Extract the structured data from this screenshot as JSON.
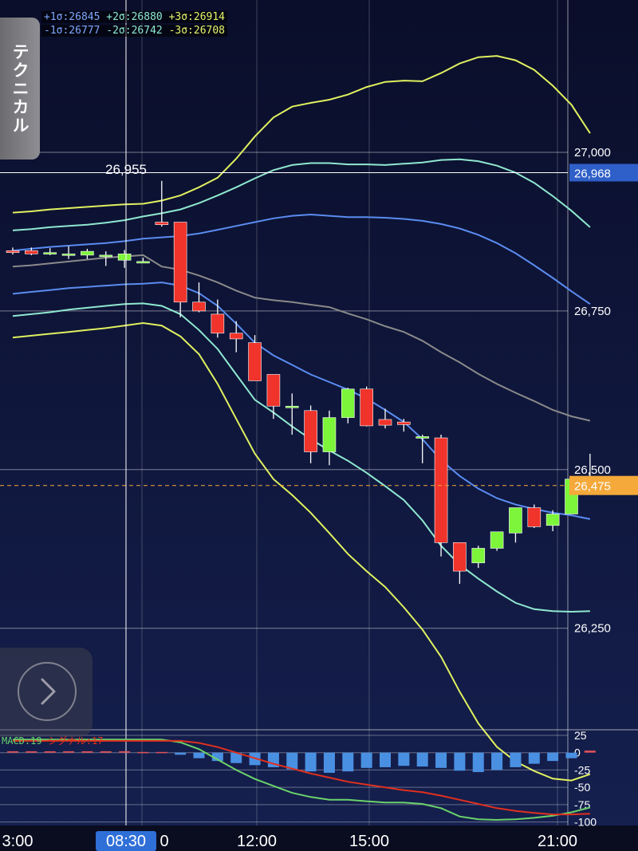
{
  "side_tab": {
    "label": "テクニカル"
  },
  "legend": {
    "plus1": "+1σ:26845",
    "plus2": "+2σ:26880",
    "plus3": "+3σ:26914",
    "minus1": "-1σ:26777",
    "minus2": "-2σ:26742",
    "minus3": "-3σ:26708"
  },
  "macd_legend": {
    "macd": "MACD:19",
    "signal": "シグナル:17"
  },
  "crosshair": {
    "price_label": "26,955",
    "time_label": "08:30"
  },
  "colors": {
    "background_top": "#0a0e2a",
    "background_bottom": "#15204f",
    "up_candle": "#7cf53a",
    "down_candle": "#f0332b",
    "sigma1": "#5a8cf0",
    "sigma2": "#8fe8d0",
    "sigma3": "#e0f060",
    "mid": "#8a8a8a",
    "macd_line": "#6bd36b",
    "signal_line": "#e0301f",
    "histogram": "#4a90e2",
    "current_price": "#f4a93a",
    "high_marker": "#2f5fc8"
  },
  "chart_data": {
    "type": "candlestick",
    "price_axis": {
      "ticks": [
        "27,000",
        "26,750",
        "26,500",
        "26,250"
      ],
      "values": [
        27000,
        26750,
        26500,
        26250
      ],
      "range": [
        26090,
        27225
      ]
    },
    "time_axis": {
      "ticks": [
        "3:00",
        "12:00",
        "15:00",
        "21:00"
      ]
    },
    "price_marker": {
      "value": 26968,
      "label": "26,968"
    },
    "current_price": {
      "value": 26475,
      "label": "26,475"
    },
    "candles": [
      {
        "o": 26845,
        "h": 26850,
        "l": 26839,
        "c": 26842
      },
      {
        "o": 26845,
        "h": 26850,
        "l": 26838,
        "c": 26840
      },
      {
        "o": 26842,
        "h": 26849,
        "l": 26838,
        "c": 26842
      },
      {
        "o": 26840,
        "h": 26852,
        "l": 26832,
        "c": 26840
      },
      {
        "o": 26838,
        "h": 26848,
        "l": 26832,
        "c": 26844
      },
      {
        "o": 26838,
        "h": 26844,
        "l": 26821,
        "c": 26838
      },
      {
        "o": 26830,
        "h": 26846,
        "l": 26818,
        "c": 26840
      },
      {
        "o": 26828,
        "h": 26834,
        "l": 26828,
        "c": 26828
      },
      {
        "o": 26890,
        "h": 26955,
        "l": 26883,
        "c": 26886
      },
      {
        "o": 26890,
        "h": 26890,
        "l": 26740,
        "c": 26764
      },
      {
        "o": 26764,
        "h": 26795,
        "l": 26748,
        "c": 26750
      },
      {
        "o": 26745,
        "h": 26768,
        "l": 26708,
        "c": 26715
      },
      {
        "o": 26715,
        "h": 26734,
        "l": 26685,
        "c": 26706
      },
      {
        "o": 26700,
        "h": 26712,
        "l": 26640,
        "c": 26640
      },
      {
        "o": 26650,
        "h": 26650,
        "l": 26580,
        "c": 26600
      },
      {
        "o": 26600,
        "h": 26620,
        "l": 26555,
        "c": 26600
      },
      {
        "o": 26593,
        "h": 26601,
        "l": 26510,
        "c": 26528
      },
      {
        "o": 26528,
        "h": 26593,
        "l": 26507,
        "c": 26582
      },
      {
        "o": 26582,
        "h": 26629,
        "l": 26573,
        "c": 26627
      },
      {
        "o": 26627,
        "h": 26631,
        "l": 26568,
        "c": 26569
      },
      {
        "o": 26579,
        "h": 26596,
        "l": 26565,
        "c": 26570
      },
      {
        "o": 26575,
        "h": 26580,
        "l": 26560,
        "c": 26571
      },
      {
        "o": 26552,
        "h": 26555,
        "l": 26510,
        "c": 26552
      },
      {
        "o": 26550,
        "h": 26555,
        "l": 26363,
        "c": 26385
      },
      {
        "o": 26385,
        "h": 26385,
        "l": 26320,
        "c": 26340
      },
      {
        "o": 26353,
        "h": 26380,
        "l": 26345,
        "c": 26376
      },
      {
        "o": 26376,
        "h": 26402,
        "l": 26372,
        "c": 26402
      },
      {
        "o": 26400,
        "h": 26440,
        "l": 26385,
        "c": 26440
      },
      {
        "o": 26440,
        "h": 26445,
        "l": 26408,
        "c": 26410
      },
      {
        "o": 26412,
        "h": 26436,
        "l": 26403,
        "c": 26430
      },
      {
        "o": 26430,
        "h": 26485,
        "l": 26430,
        "c": 26485
      },
      {
        "o": 26480,
        "h": 26525,
        "l": 26478,
        "c": 26474
      }
    ],
    "bands": {
      "mid": [
        26820,
        26822,
        26825,
        26828,
        26831,
        26834,
        26836,
        26838,
        26820,
        26815,
        26806,
        26795,
        26782,
        26771,
        26767,
        26764,
        26760,
        26756,
        26746,
        26737,
        26726,
        26717,
        26703,
        26685,
        26669,
        26651,
        26635,
        26621,
        26608,
        26594,
        26584,
        26577
      ],
      "plus1": [
        26845,
        26848,
        26851,
        26853,
        26855,
        26857,
        26860,
        26864,
        26866,
        26868,
        26872,
        26878,
        26884,
        26890,
        26896,
        26900,
        26902,
        26900,
        26898,
        26898,
        26897,
        26895,
        26892,
        26887,
        26880,
        26870,
        26857,
        26841,
        26822,
        26802,
        26781,
        26761
      ],
      "plus2": [
        26877,
        26879,
        26882,
        26884,
        26886,
        26889,
        26893,
        26899,
        26904,
        26910,
        26920,
        26932,
        26945,
        26959,
        26972,
        26980,
        26983,
        26983,
        26981,
        26981,
        26980,
        26982,
        26984,
        26988,
        26989,
        26986,
        26979,
        26968,
        26952,
        26931,
        26908,
        26882
      ],
      "plus3": [
        26905,
        26907,
        26910,
        26912,
        26914,
        26916,
        26918,
        26919,
        26924,
        26932,
        26945,
        26960,
        26990,
        27025,
        27055,
        27072,
        27078,
        27083,
        27091,
        27103,
        27111,
        27113,
        27112,
        27125,
        27140,
        27150,
        27152,
        27145,
        27130,
        27105,
        27075,
        27030
      ],
      "minus1": [
        26777,
        26780,
        26783,
        26786,
        26788,
        26790,
        26792,
        26793,
        26795,
        26790,
        26778,
        26758,
        26730,
        26700,
        26680,
        26665,
        26650,
        26638,
        26626,
        26612,
        26594,
        26575,
        26548,
        26515,
        26490,
        26470,
        26455,
        26445,
        26438,
        26432,
        26428,
        26422
      ],
      "minus2": [
        26742,
        26745,
        26748,
        26752,
        26755,
        26758,
        26761,
        26762,
        26758,
        26745,
        26720,
        26690,
        26650,
        26610,
        26590,
        26568,
        26548,
        26530,
        26514,
        26495,
        26474,
        26452,
        26420,
        26380,
        26350,
        26328,
        26308,
        26290,
        26280,
        26277,
        26276,
        26277
      ],
      "minus3": [
        26708,
        26711,
        26714,
        26717,
        26720,
        26723,
        26727,
        26731,
        26727,
        26710,
        26682,
        26635,
        26580,
        26525,
        26485,
        26460,
        26432,
        26400,
        26367,
        26340,
        26315,
        26283,
        26248,
        26205,
        26150,
        26100,
        26063,
        26040,
        26025,
        26013,
        26010,
        26020
      ]
    },
    "macd": {
      "axis_ticks": [
        "25",
        "0",
        "-25",
        "-50",
        "-75",
        "-100"
      ],
      "axis_values": [
        25,
        0,
        -25,
        -50,
        -75,
        -100
      ],
      "range": [
        -105,
        33
      ],
      "histogram": [
        2,
        2,
        2,
        2,
        2,
        2,
        2,
        1,
        1,
        -3,
        -8,
        -12,
        -15,
        -18,
        -21,
        -24,
        -27,
        -29,
        -27,
        -22,
        -21,
        -19,
        -20,
        -22,
        -26,
        -28,
        -25,
        -21,
        -16,
        -12,
        -8,
        3
      ],
      "macd_line": [
        19,
        19,
        19,
        19,
        19,
        19,
        19,
        19,
        19,
        15,
        5,
        -10,
        -25,
        -38,
        -48,
        -58,
        -64,
        -68,
        -68,
        -70,
        -72,
        -72,
        -74,
        -80,
        -92,
        -96,
        -97,
        -96,
        -94,
        -91,
        -86,
        -79
      ],
      "signal_line": [
        17,
        17,
        17,
        17,
        17,
        17,
        17,
        17,
        17,
        17,
        14,
        8,
        0,
        -8,
        -16,
        -23,
        -30,
        -36,
        -42,
        -46,
        -50,
        -54,
        -57,
        -62,
        -68,
        -74,
        -80,
        -84,
        -87,
        -89,
        -89,
        -88
      ]
    }
  }
}
